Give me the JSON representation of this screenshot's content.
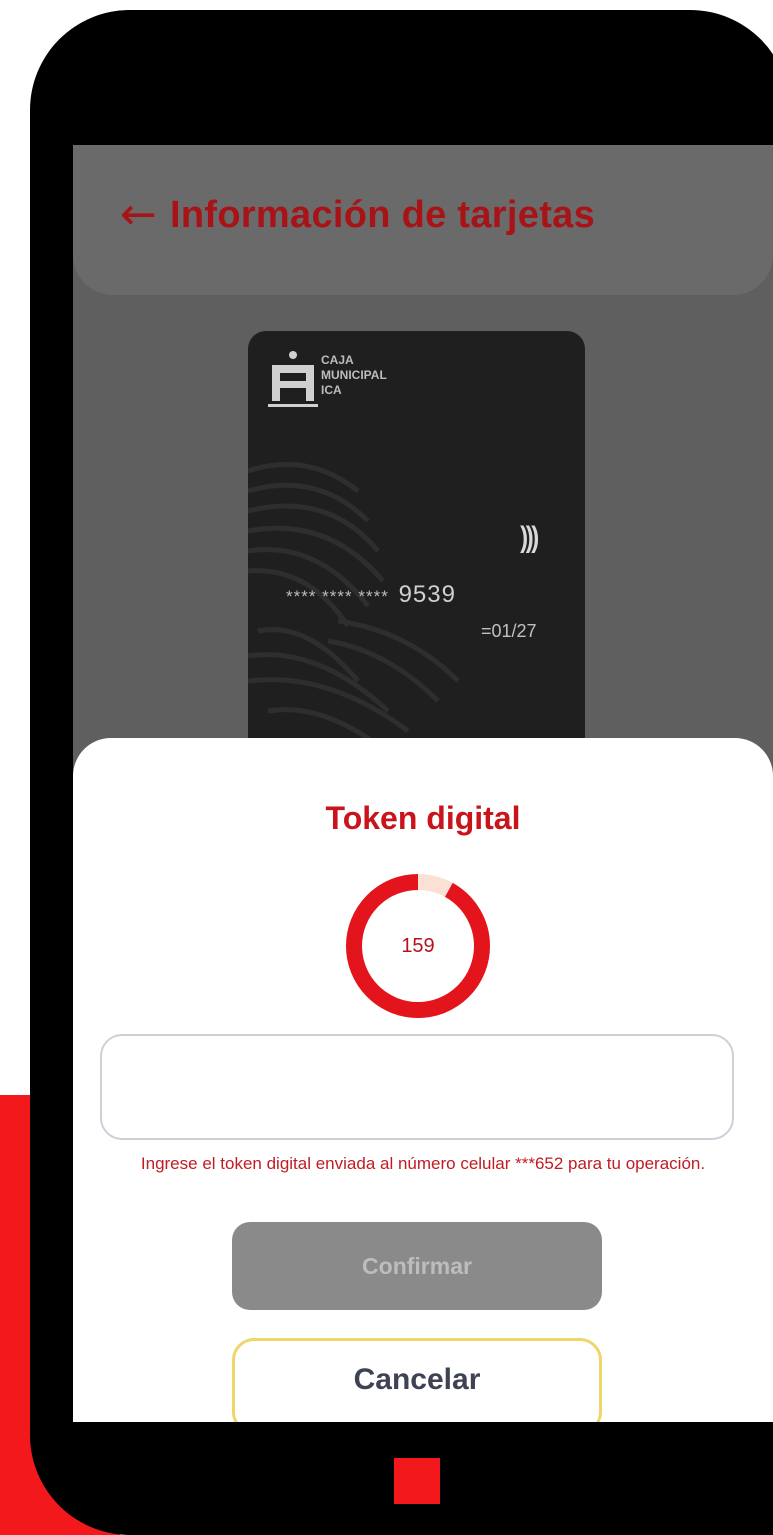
{
  "header": {
    "back_icon": "←",
    "title": "Información de tarjetas"
  },
  "card": {
    "brand_line1": "CAJA",
    "brand_line2": "MUNICIPAL",
    "brand_line3": "ICA",
    "contactless_icon": ")))",
    "masked_digits": "**** **** ****",
    "last_digits": "9539",
    "expiry": "01/27"
  },
  "token_sheet": {
    "title": "Token digital",
    "countdown": "159",
    "countdown_fraction_remaining": 0.92,
    "input_value": "",
    "hint": "Ingrese el token digital enviada al número celular ***652 para tu operación.",
    "confirm_label": "Confirmar",
    "cancel_label": "Cancelar"
  },
  "colors": {
    "brand_red": "#e3141b",
    "header_text": "#a81317",
    "confirm_disabled": "#8a8a8a",
    "cancel_border": "#efd56a"
  }
}
